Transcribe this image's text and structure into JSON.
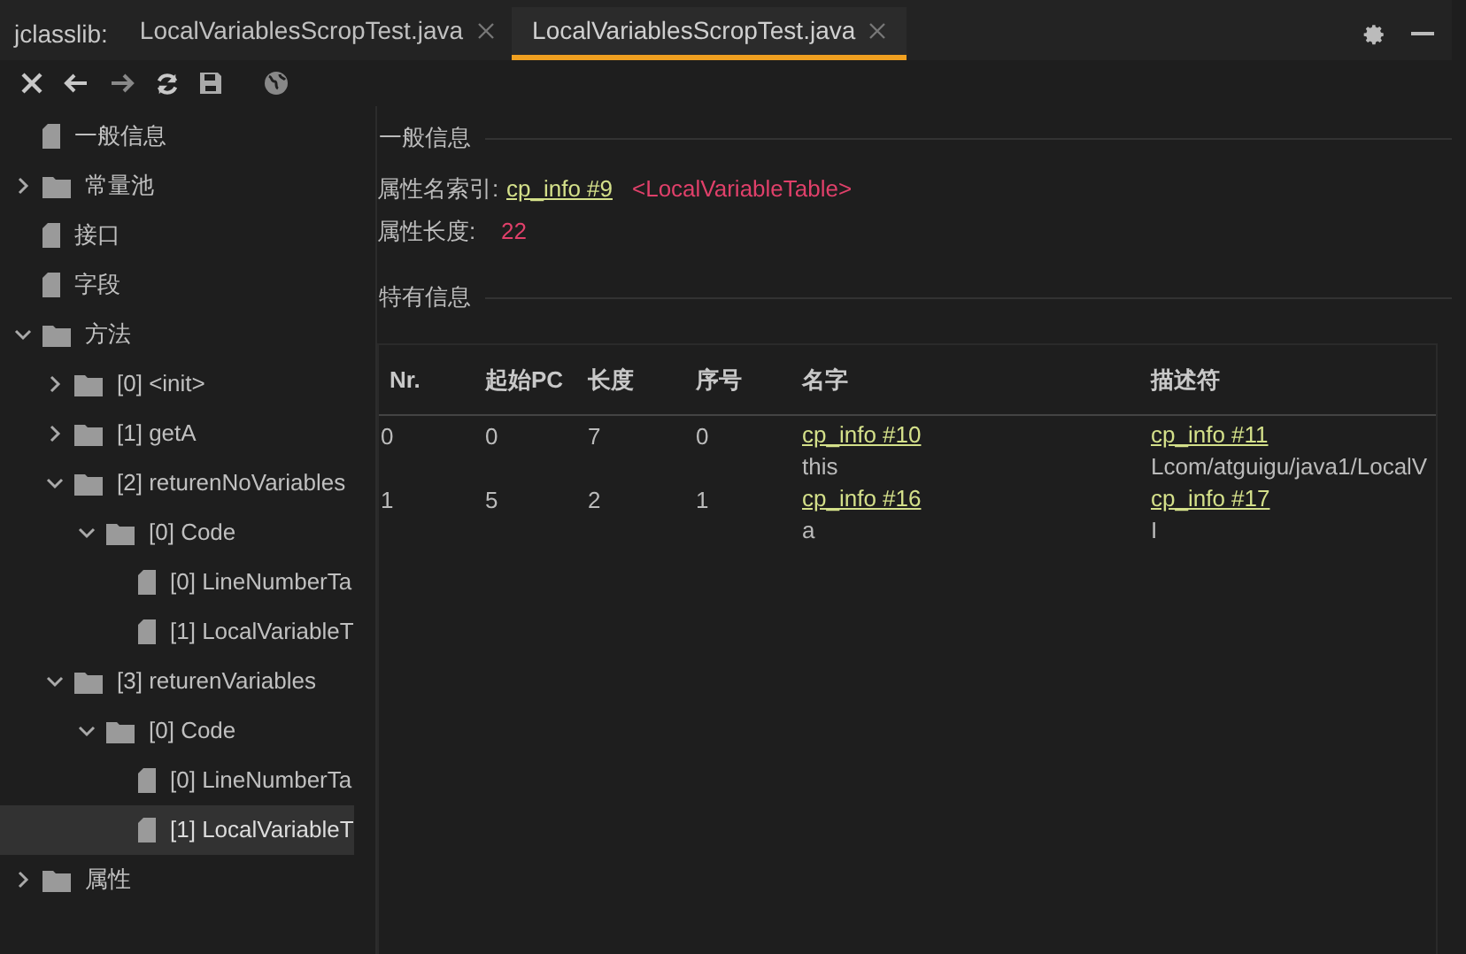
{
  "app_label": "jclasslib:",
  "tabs": [
    {
      "label": "LocalVariablesScropTest.java",
      "selected": false
    },
    {
      "label": "LocalVariablesScropTest.java",
      "selected": true
    }
  ],
  "tree": [
    {
      "label": "一般信息",
      "kind": "leaf",
      "selected": false
    },
    {
      "label": "常量池",
      "kind": "folder",
      "expanded": false,
      "selected": false
    },
    {
      "label": "接口",
      "kind": "leaf",
      "selected": false
    },
    {
      "label": "字段",
      "kind": "leaf",
      "selected": false
    },
    {
      "label": "方法",
      "kind": "folder",
      "expanded": true,
      "selected": false,
      "children": [
        {
          "label": "[0] <init>",
          "kind": "folder",
          "expanded": false,
          "selected": false
        },
        {
          "label": "[1] getA",
          "kind": "folder",
          "expanded": false,
          "selected": false
        },
        {
          "label": "[2] returenNoVariables",
          "kind": "folder",
          "expanded": true,
          "selected": false,
          "children": [
            {
              "label": "[0] Code",
              "kind": "folder",
              "expanded": true,
              "selected": false,
              "children": [
                {
                  "label": "[0] LineNumberTa",
                  "kind": "leaf",
                  "selected": false
                },
                {
                  "label": "[1] LocalVariableT",
                  "kind": "leaf",
                  "selected": false
                }
              ]
            }
          ]
        },
        {
          "label": "[3] returenVariables",
          "kind": "folder",
          "expanded": true,
          "selected": false,
          "children": [
            {
              "label": "[0] Code",
              "kind": "folder",
              "expanded": true,
              "selected": false,
              "children": [
                {
                  "label": "[0] LineNumberTa",
                  "kind": "leaf",
                  "selected": false
                },
                {
                  "label": "[1] LocalVariableT",
                  "kind": "leaf",
                  "selected": true
                }
              ]
            }
          ]
        }
      ]
    },
    {
      "label": "属性",
      "kind": "folder",
      "expanded": false,
      "selected": false
    }
  ],
  "general": {
    "title": "一般信息",
    "name_label": "属性名索引:",
    "name_link": "cp_info #9",
    "name_value": "<LocalVariableTable>",
    "length_label": "属性长度:",
    "length_value": "22"
  },
  "specific": {
    "title": "特有信息",
    "columns": [
      "Nr.",
      "起始PC",
      "长度",
      "序号",
      "名字",
      "描述符"
    ],
    "rows": [
      {
        "nr": "0",
        "start_pc": "0",
        "length": "7",
        "index": "0",
        "name_link": "cp_info #10",
        "name": "this",
        "descriptor_link": "cp_info #11",
        "descriptor": "Lcom/atguigu/java1/LocalV"
      },
      {
        "nr": "1",
        "start_pc": "5",
        "length": "2",
        "index": "1",
        "name_link": "cp_info #16",
        "name": "a",
        "descriptor_link": "cp_info #17",
        "descriptor": "I"
      }
    ]
  }
}
